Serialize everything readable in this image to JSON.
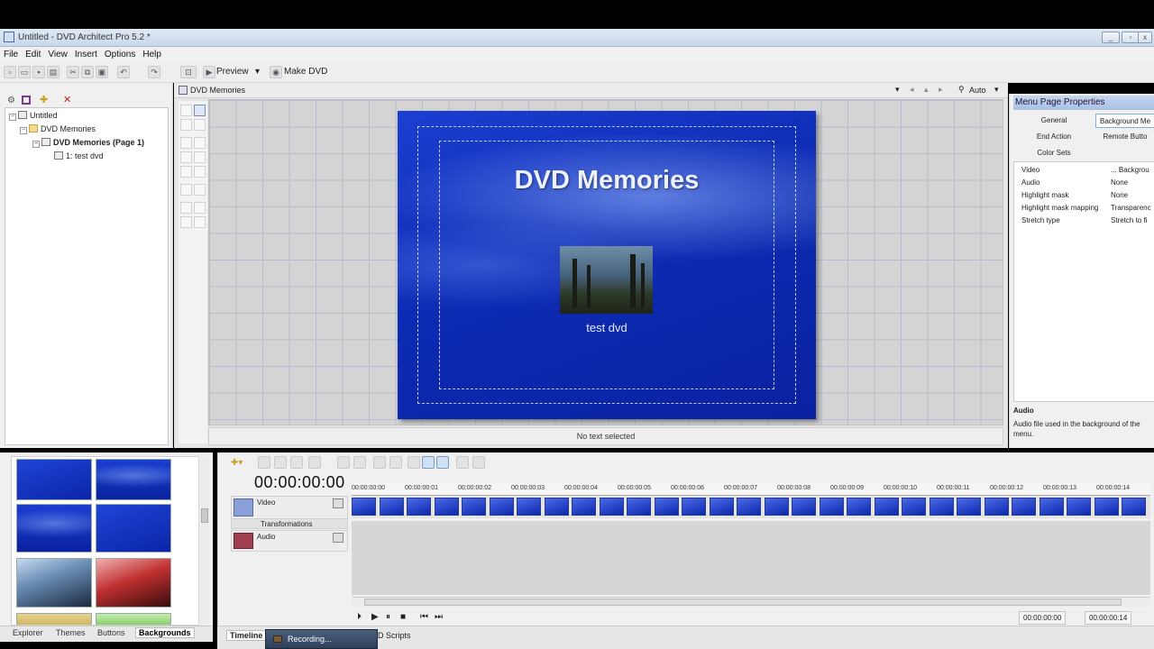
{
  "window": {
    "title": "Untitled - DVD Architect Pro 5.2 *",
    "controls": [
      "_",
      "▫",
      "x"
    ]
  },
  "menubar": {
    "items": [
      "File",
      "Edit",
      "View",
      "Insert",
      "Options",
      "Help"
    ]
  },
  "toolbar": {
    "preview_label": "Preview",
    "make_dvd_label": "Make DVD"
  },
  "project_tree": {
    "root": "Untitled",
    "items": [
      {
        "label": "DVD Memories"
      },
      {
        "label": "DVD Memories (Page 1)"
      },
      {
        "label": "1: test dvd"
      }
    ]
  },
  "workspace": {
    "tab_title": "DVD Memories",
    "zoom": "Auto",
    "status_text": "No text selected",
    "menu_title": "DVD Memories",
    "button_label": "test dvd"
  },
  "properties": {
    "header": "Menu Page Properties",
    "tabs": [
      "General",
      "Background Me",
      "End Action",
      "Remote Butto",
      "Color Sets"
    ],
    "rows": [
      {
        "key": "Video",
        "value": "... Backgrou"
      },
      {
        "key": "Audio",
        "value": "None"
      },
      {
        "key": "Highlight mask",
        "value": "None"
      },
      {
        "key": "Highlight mask mapping",
        "value": "Transparenc"
      },
      {
        "key": "Stretch type",
        "value": "Stretch to fi"
      }
    ],
    "desc_title": "Audio",
    "desc_text": "Audio file used in the background of the menu."
  },
  "bottom_left_tabs": {
    "items": [
      "Explorer",
      "Themes",
      "Buttons",
      "Backgrounds"
    ],
    "active": "Backgrounds"
  },
  "timeline": {
    "timecode": "00:00:00:00",
    "video_track": "Video",
    "transform_label": "Transformations",
    "audio_track": "Audio",
    "ruler": [
      "00:00:00:00",
      "00:00:00:01",
      "00:00:00:02",
      "00:00:00:03",
      "00:00:00:04",
      "00:00:00:05",
      "00:00:00:06",
      "00:00:00:07",
      "00:00:00:08",
      "00:00:00:09",
      "00:00:00:10",
      "00:00:00:11",
      "00:00:00:12",
      "00:00:00:13",
      "00:00:00:14"
    ],
    "start_time": "00:00:00:00",
    "end_time": "00:00:00:14"
  },
  "bottom_tabs": {
    "timeline": "Timeline",
    "scripts": "D Scripts"
  },
  "recording": {
    "label": "Recording..."
  },
  "colors": {
    "menu_blue": "#0d2bb4",
    "accent": "#a9c1e4"
  }
}
